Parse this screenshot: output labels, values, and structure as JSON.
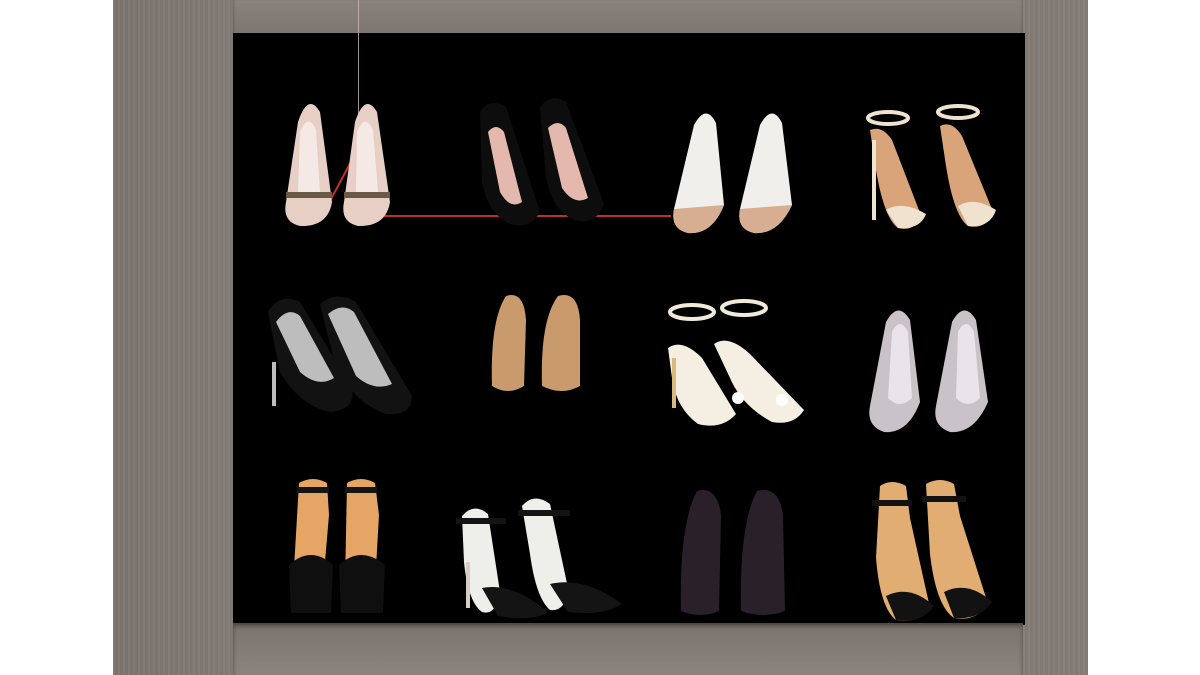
{
  "scene": {
    "description_colors": {
      "cabinet": "#847c76",
      "interior": "#000000",
      "guide_line": "#c0302a"
    }
  },
  "shoes": [
    {
      "name": "nude-chain-pump",
      "upper": "#e7cfc5",
      "inner": "#f4e9e4",
      "strap": "#6b5a45",
      "style": "pump-chain"
    },
    {
      "name": "black-pump",
      "upper": "#0d0d0d",
      "inner": "#e5b8ad",
      "strap": "",
      "style": "pump"
    },
    {
      "name": "white-nude-pump",
      "upper": "#f1efec",
      "inner": "#e7e3df",
      "strap": "",
      "style": "pump-toe"
    },
    {
      "name": "cream-ankle-sandal",
      "upper": "#f0e7d6",
      "inner": "#d9a47a",
      "strap": "#efe3cf",
      "style": "sandal"
    },
    {
      "name": "black-suede-pump",
      "upper": "#121212",
      "inner": "#bdbdbd",
      "strap": "",
      "style": "pump"
    },
    {
      "name": "tan-pump",
      "upper": "#c99a6b",
      "inner": "#101010",
      "strap": "",
      "style": "pump-dark"
    },
    {
      "name": "pearl-sandal",
      "upper": "#f4efe2",
      "inner": "#e5dccb",
      "strap": "#f1eadb",
      "style": "sandal"
    },
    {
      "name": "grey-pump",
      "upper": "#c9c2c8",
      "inner": "#eae3ea",
      "strap": "",
      "style": "pump"
    },
    {
      "name": "black-platform-sandal",
      "upper": "#0f0f0f",
      "inner": "#e4a565",
      "strap": "#151515",
      "style": "sandal"
    },
    {
      "name": "white-black-sandal",
      "upper": "#eeeeea",
      "inner": "#dcdcd8",
      "strap": "#141414",
      "style": "sandal"
    },
    {
      "name": "plum-pump",
      "upper": "#2a2029",
      "inner": "#3a2e38",
      "strap": "",
      "style": "pump-dark"
    },
    {
      "name": "black-strap-sandal",
      "upper": "#141414",
      "inner": "#e1ad73",
      "strap": "#121212",
      "style": "sandal"
    }
  ]
}
